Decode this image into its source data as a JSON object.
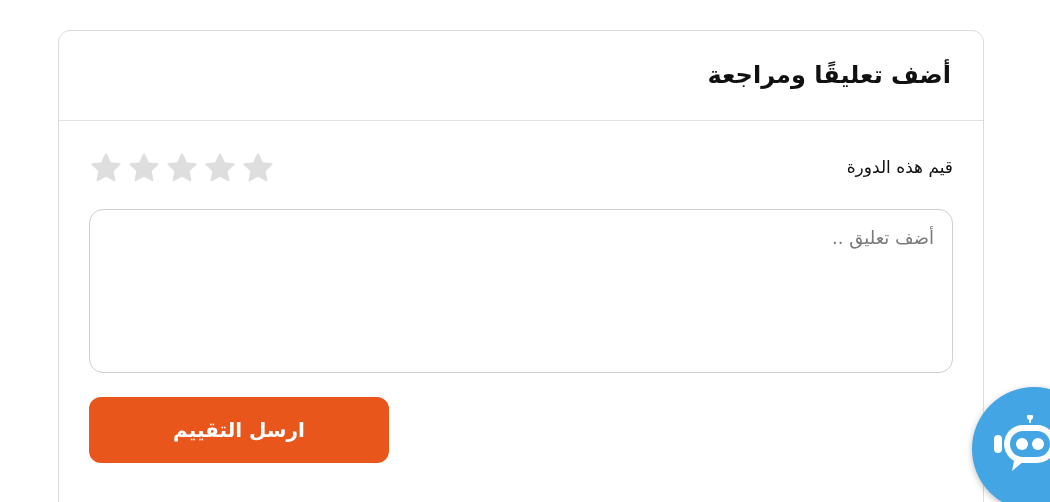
{
  "review_card": {
    "title": "أضف تعليقًا ومراجعة",
    "rating_label": "قيم هذه الدورة",
    "stars": 0,
    "comment_field": {
      "placeholder": "أضف تعليق .."
    },
    "submit_button": "ارسل التقييم"
  }
}
